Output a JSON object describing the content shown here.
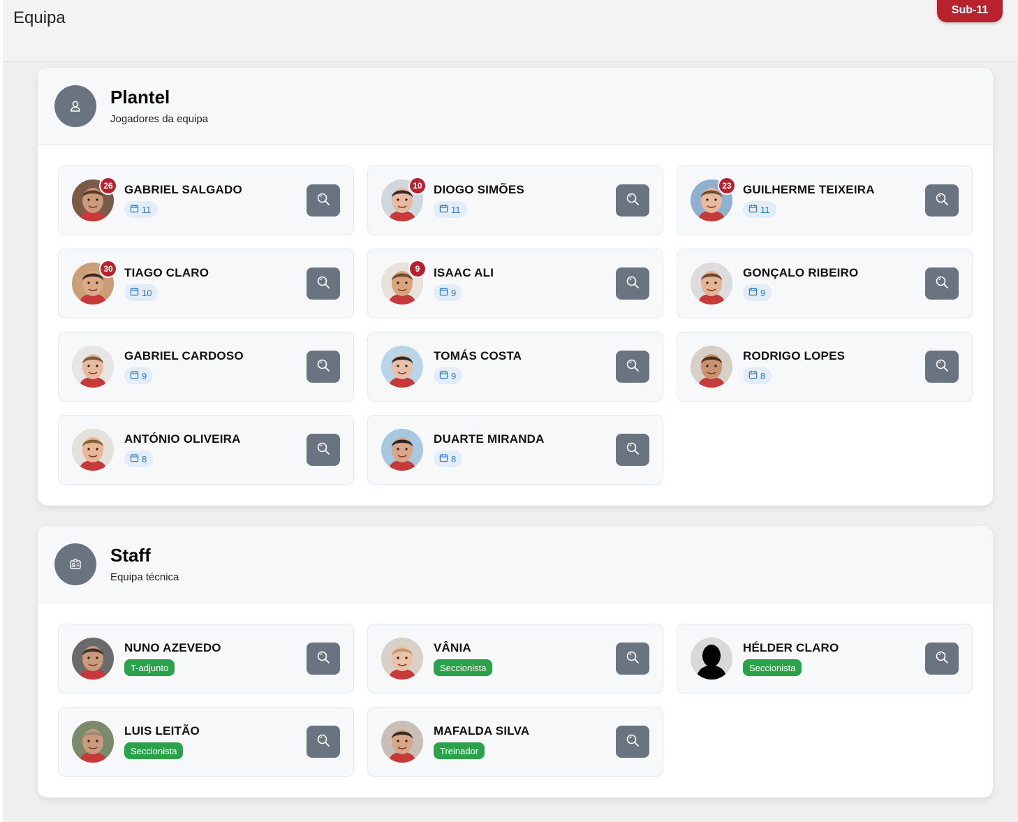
{
  "header": {
    "title": "Equipa",
    "team_badge": "Sub-11"
  },
  "colors": {
    "accent_red": "#b8212e",
    "button_gray": "#6a7380",
    "role_green": "#2aa24a",
    "games_blue": "#2f77c5"
  },
  "plantel": {
    "title": "Plantel",
    "subtitle": "Jogadores da equipa",
    "icon": "user-icon",
    "players": [
      {
        "name": "GABRIEL SALGADO",
        "number": "26",
        "games": "11",
        "skin": "#c99a7c",
        "hair": "#5a3a22",
        "bg": "#7a5a48"
      },
      {
        "name": "DIOGO SIMÕES",
        "number": "10",
        "games": "11",
        "skin": "#e7b9a0",
        "hair": "#3a2a20",
        "bg": "#cfd7df"
      },
      {
        "name": "GUILHERME TEIXEIRA",
        "number": "23",
        "games": "11",
        "skin": "#e8b99c",
        "hair": "#6b4a2e",
        "bg": "#8fb0cf"
      },
      {
        "name": "TIAGO CLARO",
        "number": "30",
        "games": "10",
        "skin": "#d9a98a",
        "hair": "#3b2b20",
        "bg": "#c99f78"
      },
      {
        "name": "ISAAC ALI",
        "number": "9",
        "games": "9",
        "skin": "#d8a57f",
        "hair": "#6b4a2e",
        "bg": "#e8e2dc"
      },
      {
        "name": "GONÇALO RIBEIRO",
        "number": "",
        "games": "9",
        "skin": "#e4b396",
        "hair": "#6a4a30",
        "bg": "#dcdcdc"
      },
      {
        "name": "GABRIEL CARDOSO",
        "number": "",
        "games": "9",
        "skin": "#e6bba0",
        "hair": "#7a5a3a",
        "bg": "#e6e6e6"
      },
      {
        "name": "TOMÁS COSTA",
        "number": "",
        "games": "9",
        "skin": "#e8c0a8",
        "hair": "#2a2a2a",
        "bg": "#b8d6e8"
      },
      {
        "name": "RODRIGO LOPES",
        "number": "",
        "games": "8",
        "skin": "#c9936f",
        "hair": "#4a3020",
        "bg": "#d6d0c8"
      },
      {
        "name": "ANTÓNIO OLIVEIRA",
        "number": "",
        "games": "8",
        "skin": "#e6b898",
        "hair": "#8a5e38",
        "bg": "#e4e0dc"
      },
      {
        "name": "DUARTE MIRANDA",
        "number": "",
        "games": "8",
        "skin": "#d8a688",
        "hair": "#2a2420",
        "bg": "#a8c8e0"
      }
    ]
  },
  "staff": {
    "title": "Staff",
    "subtitle": "Equipa técnica",
    "icon": "id-card-icon",
    "members": [
      {
        "name": "NUNO AZEVEDO",
        "role": "T-adjunto",
        "skin": "#c99a7c",
        "hair": "#3a3028",
        "bg": "#6a6a6a"
      },
      {
        "name": "VÂNIA",
        "role": "Seccionista",
        "skin": "#eac2a8",
        "hair": "#c29a6a",
        "bg": "#d9d0c8"
      },
      {
        "name": "HÉLDER CLARO",
        "role": "Seccionista",
        "skin": "#000000",
        "hair": "#000000",
        "bg": "#d8d8d8"
      },
      {
        "name": "LUIS LEITÃO",
        "role": "Seccionista",
        "skin": "#c99a7c",
        "hair": "#9a8a7a",
        "bg": "#7a8a6a"
      },
      {
        "name": "MAFALDA SILVA",
        "role": "Treinador",
        "skin": "#d8a688",
        "hair": "#3a2a20",
        "bg": "#c8c0b8"
      }
    ]
  }
}
